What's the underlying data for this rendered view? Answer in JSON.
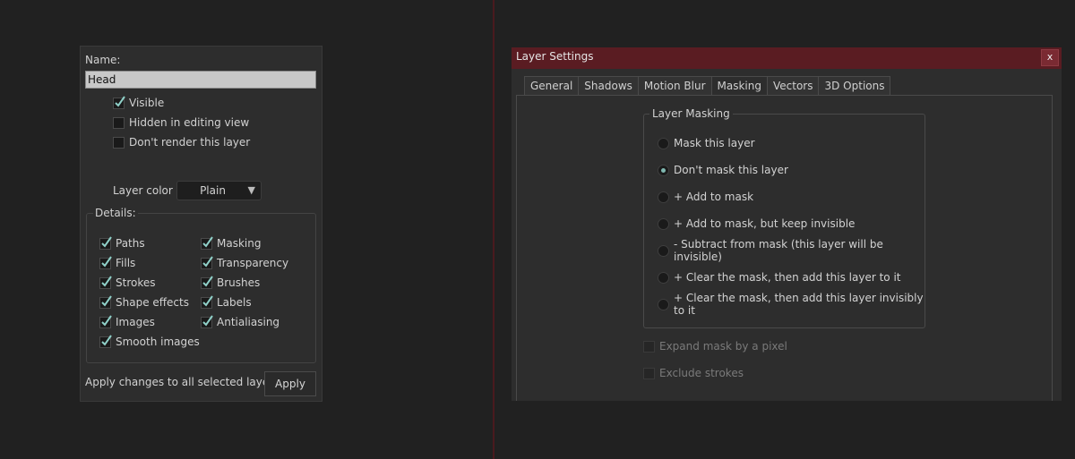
{
  "layer_panel": {
    "name_label": "Name:",
    "name_value": "Head",
    "options": [
      {
        "label": "Visible",
        "checked": true
      },
      {
        "label": "Hidden in editing view",
        "checked": false
      },
      {
        "label": "Don't render this layer",
        "checked": false
      }
    ],
    "layer_color_label": "Layer color",
    "layer_color_value": "Plain",
    "details_label": "Details:",
    "details_left": [
      {
        "label": "Paths",
        "checked": true
      },
      {
        "label": "Fills",
        "checked": true
      },
      {
        "label": "Strokes",
        "checked": true
      },
      {
        "label": "Shape effects",
        "checked": true
      },
      {
        "label": "Images",
        "checked": true
      },
      {
        "label": "Smooth images",
        "checked": true
      }
    ],
    "details_right": [
      {
        "label": "Masking",
        "checked": true
      },
      {
        "label": "Transparency",
        "checked": true
      },
      {
        "label": "Brushes",
        "checked": true
      },
      {
        "label": "Labels",
        "checked": true
      },
      {
        "label": "Antialiasing",
        "checked": true
      }
    ],
    "apply_label": "Apply changes to all selected layers:",
    "apply_button": "Apply"
  },
  "dialog": {
    "title": "Layer Settings",
    "close_glyph": "x",
    "tabs": [
      "General",
      "Shadows",
      "Motion Blur",
      "Masking",
      "Vectors",
      "3D Options"
    ],
    "active_tab": "Masking",
    "group_label": "Layer Masking",
    "radio_options": [
      {
        "label": "Mask this layer",
        "selected": false
      },
      {
        "label": "Don't mask this layer",
        "selected": true
      },
      {
        "label": "+ Add to mask",
        "selected": false
      },
      {
        "label": "+ Add to mask, but keep invisible",
        "selected": false
      },
      {
        "label": "- Subtract from mask (this layer will be invisible)",
        "selected": false
      },
      {
        "label": "+ Clear the mask, then add this layer to it",
        "selected": false
      },
      {
        "label": "+ Clear the mask, then add this layer invisibly to it",
        "selected": false
      }
    ],
    "extra_options": [
      {
        "label": "Expand mask by a pixel",
        "checked": false,
        "disabled": true
      },
      {
        "label": "Exclude strokes",
        "checked": false,
        "disabled": true
      }
    ]
  },
  "colors": {
    "title_bar": "#5a1c22",
    "check_mark": "#8fd0c8",
    "radio_dot": "#7fb8b0"
  }
}
